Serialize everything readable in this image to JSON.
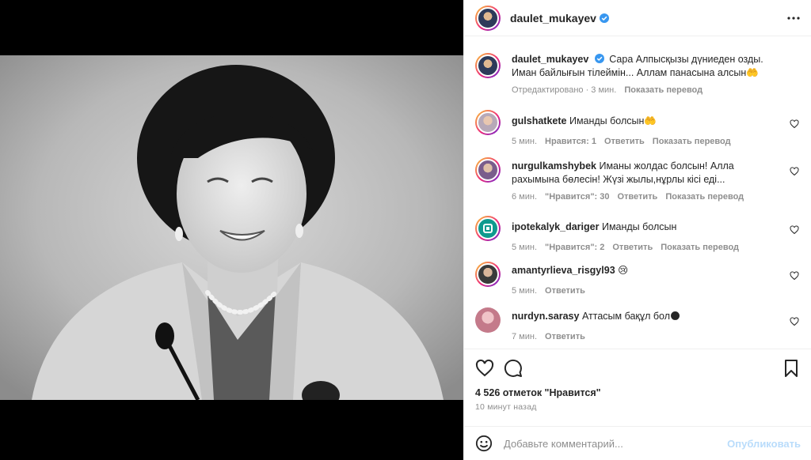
{
  "post": {
    "author": "daulet_mukayev",
    "caption": "Сара Алпысқызы дүниеден озды. Иман байлығын тілеймін... Аллам панасына алсын🤲",
    "edited_label": "Отредактировано",
    "time": "3 мин.",
    "translate_label": "Показать перевод"
  },
  "comments": [
    {
      "user": "gulshatkete",
      "text": "Иманды болсын🤲",
      "time": "5 мин.",
      "likes": "Нравится: 1",
      "reply": "Ответить",
      "translate": "Показать перевод"
    },
    {
      "user": "nurgulkamshybek",
      "text": "Иманы жолдас болсын! Алла рахымына бөлесін! Жүзі жылы,нұрлы кісі еді...",
      "time": "6 мин.",
      "likes": "\"Нравится\": 30",
      "reply": "Ответить",
      "translate": "Показать перевод"
    },
    {
      "user": "ipotekalyk_dariger",
      "text": "Иманды болсын",
      "time": "5 мин.",
      "likes": "\"Нравится\": 2",
      "reply": "Ответить",
      "translate": "Показать перевод"
    },
    {
      "user": "amantyrlieva_risgyl93",
      "text": "😢",
      "time": "5 мин.",
      "reply": "Ответить"
    },
    {
      "user": "nurdyn.sarasy",
      "text": "Аттасым бақұл бол🌑",
      "time": "7 мин.",
      "reply": "Ответить"
    }
  ],
  "stats": {
    "likes": "4 526 отметок \"Нравится\"",
    "ago": "10 минут назад"
  },
  "composer": {
    "placeholder": "Добавьте комментарий...",
    "publish": "Опубликовать"
  },
  "colors": {
    "accent": "#0095f6",
    "verified": "#3897f0",
    "muted": "#8e8e8e"
  }
}
